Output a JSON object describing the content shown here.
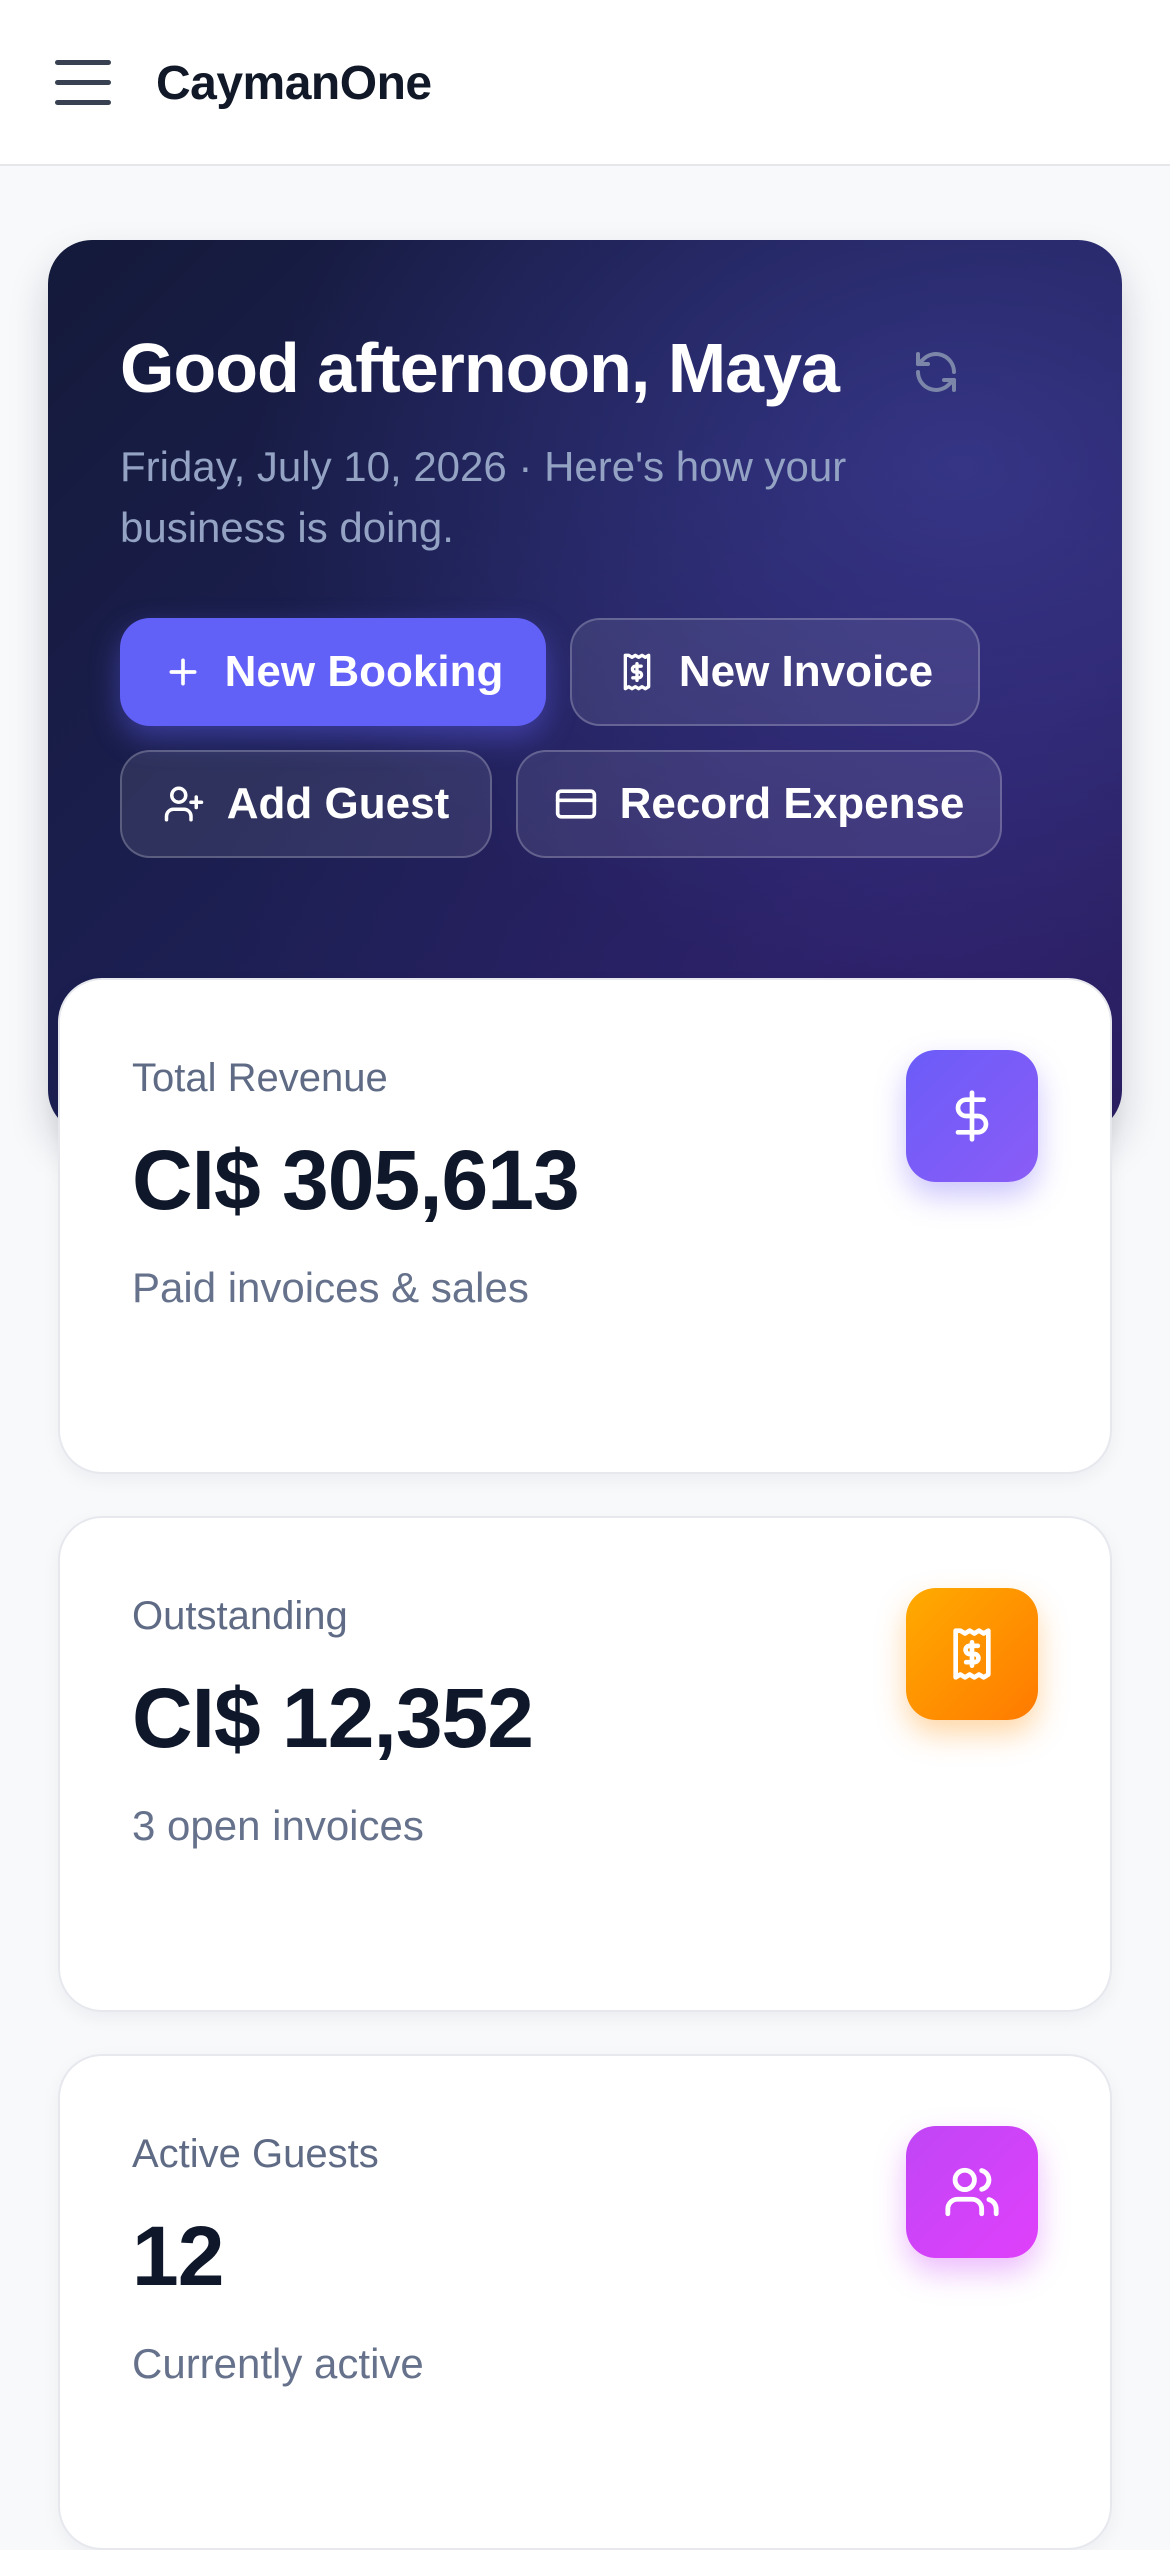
{
  "app": {
    "brand": "CaymanOne"
  },
  "hero": {
    "greeting": "Good afternoon, Maya",
    "subline": "Friday, July 10, 2026 · Here's how your business is doing.",
    "actions": [
      {
        "label": "New Booking",
        "icon": "plus-icon"
      },
      {
        "label": "New Invoice",
        "icon": "receipt-icon"
      },
      {
        "label": "Add Guest",
        "icon": "user-plus-icon"
      },
      {
        "label": "Record Expense",
        "icon": "credit-card-icon"
      }
    ]
  },
  "stats": [
    {
      "label": "Total Revenue",
      "value": "CI$ 305,613",
      "sub": "Paid invoices & sales",
      "icon": "dollar-icon",
      "color": "#6b5cf9"
    },
    {
      "label": "Outstanding",
      "value": "CI$ 12,352",
      "sub": "3 open invoices",
      "icon": "receipt-icon",
      "color": "#ff9500"
    },
    {
      "label": "Active Guests",
      "value": "12",
      "sub": "Currently active",
      "icon": "users-icon",
      "color": "#d044f8"
    }
  ]
}
